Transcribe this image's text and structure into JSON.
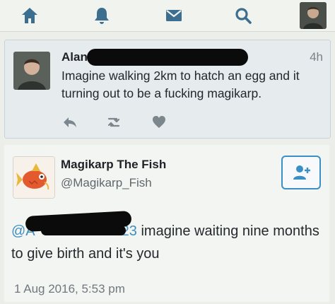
{
  "nav": {
    "icons": [
      "home-icon",
      "notifications-icon",
      "messages-icon",
      "search-icon",
      "profile-avatar"
    ]
  },
  "tweet1": {
    "name_visible": "Alan Dal",
    "time": "4h",
    "text": "Imagine walking 2km to hatch an egg and it turning out to be a fucking magikarp.",
    "actions": [
      "reply-icon",
      "retweet-icon",
      "like-icon"
    ]
  },
  "tweet2": {
    "name": "Magikarp The Fish",
    "handle": "@Magikarp_Fish",
    "mention_visible": "@A",
    "mention_tail": "23",
    "text": " imagine waiting nine months to give birth and it's you",
    "date": "1 Aug 2016, 5:53 pm",
    "follow_icon": "add-user-icon"
  },
  "colors": {
    "accent": "#3a8fc4",
    "nav_icon": "#3b6e8f",
    "redaction": "#0b0b0b"
  }
}
